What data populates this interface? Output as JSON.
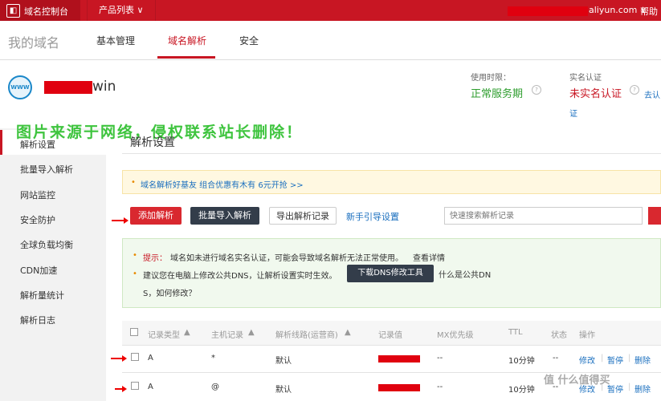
{
  "topbar": {
    "title": "域名控制台",
    "products_label": "产品列表 ∨",
    "account_suffix": "aliyun.com ∨",
    "help": "帮助"
  },
  "nav": {
    "page_heading": "我的域名",
    "tabs": [
      {
        "label": "基本管理",
        "active": false
      },
      {
        "label": "域名解析",
        "active": true
      },
      {
        "label": "安全",
        "active": false
      }
    ]
  },
  "domain": {
    "icon_text": "WWW",
    "name_suffix": "win",
    "period_label": "使用时限：",
    "period_value": "正常服务期",
    "realname_label": "实名认证",
    "realname_value": "未实名认证",
    "realname_link_a": "去认",
    "realname_link_b": "证"
  },
  "watermark": "图片来源于网络，侵权联系站长删除！",
  "sidebar": {
    "items": [
      {
        "label": "解析设置"
      },
      {
        "label": "批量导入解析"
      },
      {
        "label": "网站监控"
      },
      {
        "label": "安全防护"
      },
      {
        "label": "全球负载均衡"
      },
      {
        "label": "CDN加速"
      },
      {
        "label": "解析量统计"
      },
      {
        "label": "解析日志"
      }
    ]
  },
  "main": {
    "title": "解析设置",
    "promo": "域名解析好基友 组合优惠有木有 6元开抢 >>",
    "buttons": {
      "add": "添加解析",
      "batch": "批量导入解析",
      "export": "导出解析记录",
      "guide": "新手引导设置"
    },
    "search_placeholder": "快速搜索解析记录",
    "tips": {
      "line1_label": "提示：",
      "line1_text": "域名如未进行域名实名认证，可能会导致域名解析无法正常使用。",
      "line1_link": "查看详情",
      "line2_text": "建议您在电脑上修改公共DNS，让解析设置实时生效。",
      "dns_button": "下载DNS修改工具",
      "line2_link_a": "什么是公共DN",
      "line2_link_b": "S，如何修改？"
    }
  },
  "table": {
    "headers": [
      "记录类型",
      "主机记录",
      "解析线路(运营商)",
      "记录值",
      "MX优先级",
      "TTL",
      "状态",
      "操作"
    ],
    "rows": [
      {
        "type": "A",
        "host": "*",
        "line": "默认",
        "mx": "--",
        "ttl": "10分钟",
        "status": "--",
        "ops": [
          "修改",
          "暂停",
          "删除"
        ]
      },
      {
        "type": "A",
        "host": "@",
        "line": "默认",
        "mx": "--",
        "ttl": "10分钟",
        "status": "--",
        "ops": [
          "修改",
          "暂停",
          "删除"
        ]
      }
    ]
  },
  "corner_watermark": "值 什么值得买",
  "colors": {
    "brand_red": "#c81623",
    "link_blue": "#1a6fbf",
    "ok_green": "#2f9e2f",
    "dark_button": "#333d4a"
  }
}
